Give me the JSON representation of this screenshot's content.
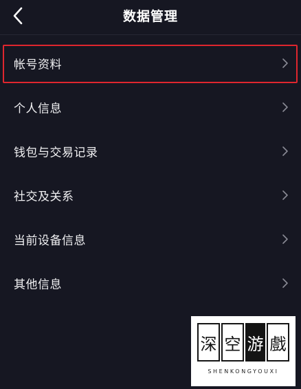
{
  "header": {
    "title": "数据管理",
    "back_icon": "chevron-left-icon"
  },
  "menu": {
    "items": [
      {
        "label": "帐号资料",
        "highlighted": true
      },
      {
        "label": "个人信息",
        "highlighted": false
      },
      {
        "label": "钱包与交易记录",
        "highlighted": false
      },
      {
        "label": "社交及关系",
        "highlighted": false
      },
      {
        "label": "当前设备信息",
        "highlighted": false
      },
      {
        "label": "其他信息",
        "highlighted": false
      }
    ],
    "chevron_icon": "chevron-right-icon"
  },
  "watermark": {
    "chars": [
      "深",
      "空",
      "游",
      "戲"
    ],
    "pinyin": "SHENKONGYOUXI"
  },
  "colors": {
    "background": "#161722",
    "text": "#f2f2f4",
    "chevron": "#8a8b95",
    "highlight_border": "#e0262e"
  }
}
